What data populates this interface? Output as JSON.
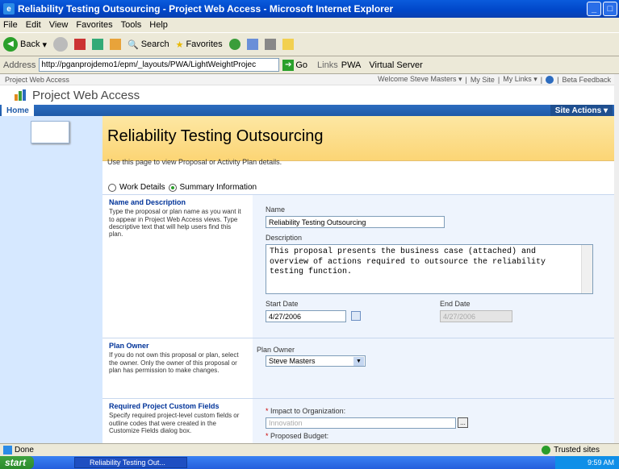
{
  "window": {
    "title": "Reliability Testing Outsourcing - Project Web Access - Microsoft Internet Explorer"
  },
  "menu": [
    "File",
    "Edit",
    "View",
    "Favorites",
    "Tools",
    "Help"
  ],
  "toolbar": {
    "back": "Back",
    "search": "Search",
    "favorites": "Favorites"
  },
  "address": {
    "label": "Address",
    "url": "http://pganprojdemo1/epm/_layouts/PWA/LightWeightProjec",
    "go": "Go",
    "links": "Links",
    "pwa": "PWA",
    "virtual_server": "Virtual Server"
  },
  "site": {
    "crumb": "Project Web Access",
    "welcome": "Welcome Steve Masters ▾",
    "my_site": "My Site",
    "my_links": "My Links ▾",
    "beta": "Beta Feedback",
    "header_title": "Project Web Access",
    "home_tab": "Home",
    "site_actions": "Site Actions ▾"
  },
  "page": {
    "title": "Reliability Testing Outsourcing",
    "intro": "Use this page to view Proposal or Activity Plan details.",
    "radio_work": "Work Details",
    "radio_summary": "Summary Information"
  },
  "name_section": {
    "heading": "Name and Description",
    "help": "Type the proposal or plan name as you want it to appear in Project Web Access views. Type descriptive text that will help users find this plan.",
    "name_label": "Name",
    "name_value": "Reliability Testing Outsourcing",
    "desc_label": "Description",
    "desc_value": "This proposal presents the business case (attached) and overview of actions required to outsource the reliability testing function.",
    "start_label": "Start Date",
    "start_value": "4/27/2006",
    "end_label": "End Date",
    "end_value": "4/27/2006"
  },
  "owner_section": {
    "heading": "Plan Owner",
    "help": "If you do not own this proposal or plan, select the owner. Only the owner of this proposal or plan has permission to make changes.",
    "owner_label": "Plan Owner",
    "owner_value": "Steve Masters"
  },
  "custom_section": {
    "heading": "Required Project Custom Fields",
    "help": "Specify required project-level custom fields or outline codes that were created in the Customize Fields dialog box.",
    "impact_label": "Impact to Organization:",
    "impact_value": "Innovation",
    "budget_label": "Proposed Budget:",
    "required_mark": "*"
  },
  "status": {
    "left": "Done",
    "zone": "Trusted sites"
  },
  "taskbar": {
    "start": "start",
    "task": "Reliability Testing Out...",
    "clock": "9:59 AM"
  }
}
